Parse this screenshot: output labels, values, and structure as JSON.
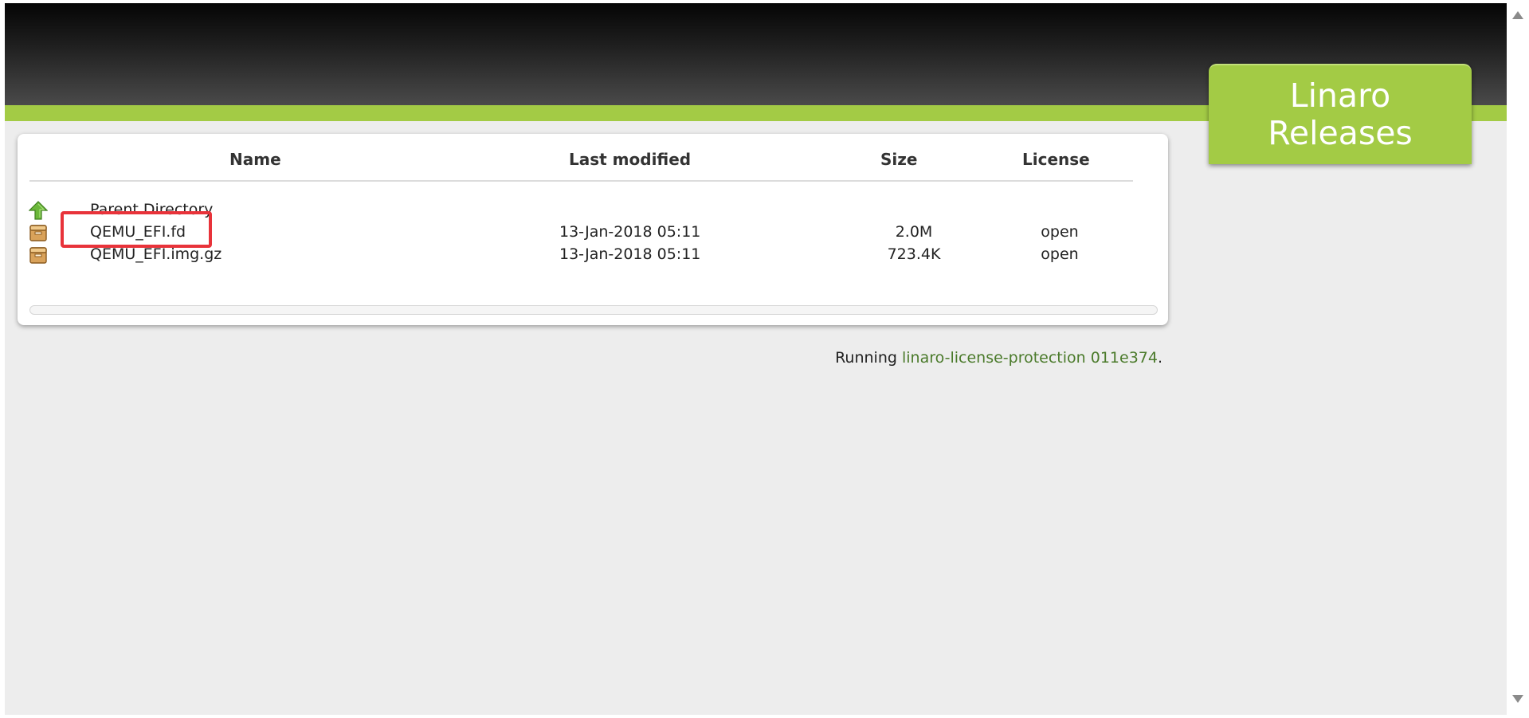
{
  "brand": {
    "line1": "Linaro",
    "line2": "Releases"
  },
  "table": {
    "columns": {
      "name": "Name",
      "last_modified": "Last modified",
      "size": "Size",
      "license": "License"
    },
    "parent": {
      "label": "Parent Directory",
      "icon": "up-arrow-icon"
    },
    "rows": [
      {
        "name": "QEMU_EFI.fd",
        "modified": "13-Jan-2018 05:11",
        "size": "2.0M",
        "license": "open",
        "icon": "package-icon"
      },
      {
        "name": "QEMU_EFI.img.gz",
        "modified": "13-Jan-2018 05:11",
        "size": "723.4K",
        "license": "open",
        "icon": "package-icon"
      }
    ]
  },
  "footer": {
    "prefix": "Running ",
    "link": "linaro-license-protection 011e374",
    "suffix": "."
  },
  "colors": {
    "accent_green": "#a3cb45",
    "link_green": "#4a7a2a",
    "highlight_red": "#e8333a"
  }
}
